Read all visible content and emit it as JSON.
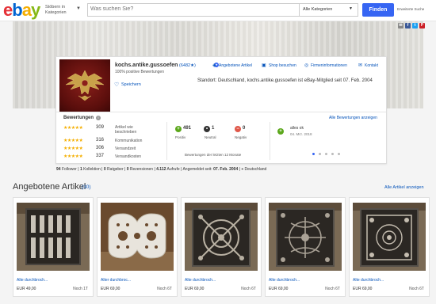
{
  "header": {
    "logo_letters": [
      "e",
      "b",
      "a",
      "y"
    ],
    "logo_colors": [
      "#e53238",
      "#0064d2",
      "#f5af02",
      "#86b817"
    ],
    "browse_label": "Stöbern in Kategorien",
    "search_placeholder": "Was suchen Sie?",
    "category_select": "Alle Kategorien",
    "search_button": "Finden",
    "advanced_search": "Erweiterte Suche"
  },
  "share_icons": [
    {
      "name": "email-icon",
      "glyph": "✉",
      "color": "#888888"
    },
    {
      "name": "facebook-icon",
      "glyph": "f",
      "color": "#3b5998"
    },
    {
      "name": "twitter-icon",
      "glyph": "t",
      "color": "#1da1f2"
    },
    {
      "name": "pinterest-icon",
      "glyph": "P",
      "color": "#cb2027"
    }
  ],
  "seller": {
    "name": "kochs.antike.gussoefen",
    "feedback_count": "(6482★)",
    "positive": "100% positive Bewertungen",
    "save": "Speichern",
    "member_since": "Standort: Deutschland, kochs.antike.gussoefen ist eBay-Mitglied seit 07. Feb. 2004",
    "links": [
      "Angebotene Artikel",
      "Shop besuchen",
      "Firmeninformationen",
      "Kontakt"
    ]
  },
  "ratings": {
    "title": "Bewertungen",
    "all_link": "Alle Bewertungen anzeigen",
    "detailed": [
      {
        "value": "309",
        "label": "Artikel wie beschrieben"
      },
      {
        "value": "316",
        "label": "Kommunikation"
      },
      {
        "value": "306",
        "label": "Versandzeit"
      },
      {
        "value": "337",
        "label": "Versandkosten"
      }
    ],
    "feedback": [
      {
        "count": "491",
        "label": "Positiv",
        "symbol": "+",
        "color": "#5ba71b"
      },
      {
        "count": "1",
        "label": "Neutral",
        "symbol": "•",
        "color": "#555555"
      },
      {
        "count": "0",
        "label": "Negativ",
        "symbol": "−",
        "color": "#e0584a"
      }
    ],
    "period": "Bewertungen der letzten 12 Monate",
    "latest_review": "alles ok",
    "latest_date": "04. Mrz. 2018"
  },
  "stats": {
    "followers": "94",
    "followers_label": "Follower",
    "collection": "1",
    "collection_label": "Kollektion",
    "guides": "0",
    "guides_label": "Ratgeber",
    "reviews": "0",
    "reviews_label": "Rezensionen",
    "views": "4.112",
    "views_label": "Aufrufe",
    "member_label": "Angemeldet seit:",
    "member_date": "07. Feb. 2004",
    "location": "Deutschland"
  },
  "items_section": {
    "title": "Angebotene Artikel",
    "count": "(30)",
    "all_link": "Alle Artikel anzeigen"
  },
  "items": [
    {
      "title": "Alte durchbroch...",
      "price": "EUR 49,00",
      "time": "Noch 1T"
    },
    {
      "title": "Alter durchbroc...",
      "price": "EUR 69,00",
      "time": "Noch 6T"
    },
    {
      "title": "Alte durchbroch...",
      "price": "EUR 69,00",
      "time": "Noch 6T"
    },
    {
      "title": "Alte durchbroch...",
      "price": "EUR 69,00",
      "time": "Noch 6T"
    },
    {
      "title": "Alte durchbroch...",
      "price": "EUR 69,00",
      "time": "Noch 6T"
    }
  ]
}
